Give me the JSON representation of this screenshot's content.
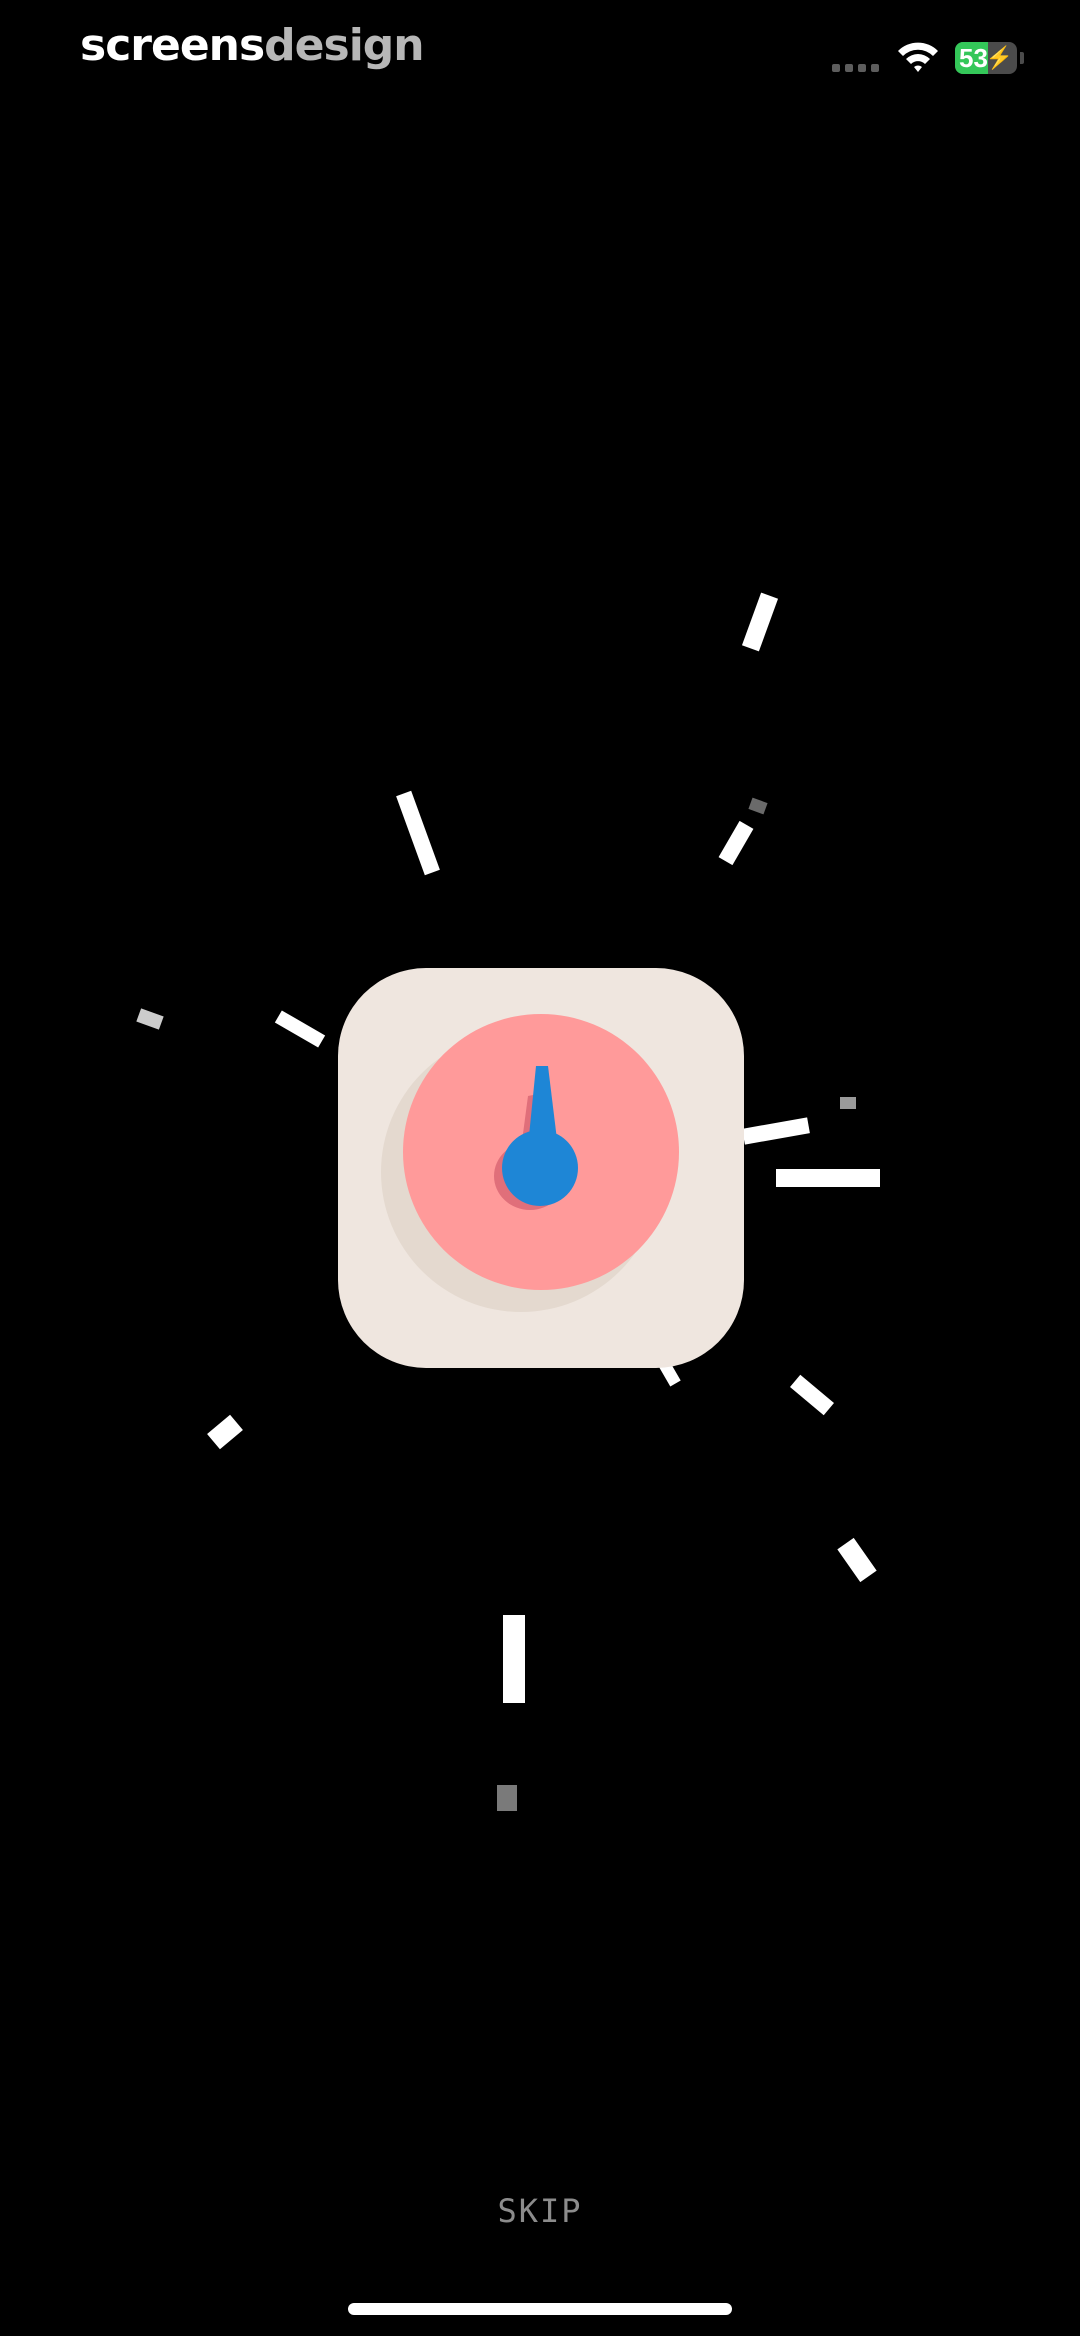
{
  "watermark": {
    "bold_part": "screens",
    "light_part": "design"
  },
  "status_bar": {
    "battery_level": "53",
    "battery_percent": 53,
    "charging_icon": "bolt-icon",
    "wifi_icon": "wifi-icon",
    "signal_icon": "cellular-signal-icon"
  },
  "splash": {
    "icon_name": "timer-app-icon",
    "burst_icon": "confetti-burst"
  },
  "skip_label": "SKIP",
  "colors": {
    "background": "#000000",
    "icon_tile": "#efe6df",
    "dial": "#ff9a9a",
    "needle": "#1e86d6",
    "skip_text": "#8c8c8c",
    "battery": "#34c759"
  }
}
